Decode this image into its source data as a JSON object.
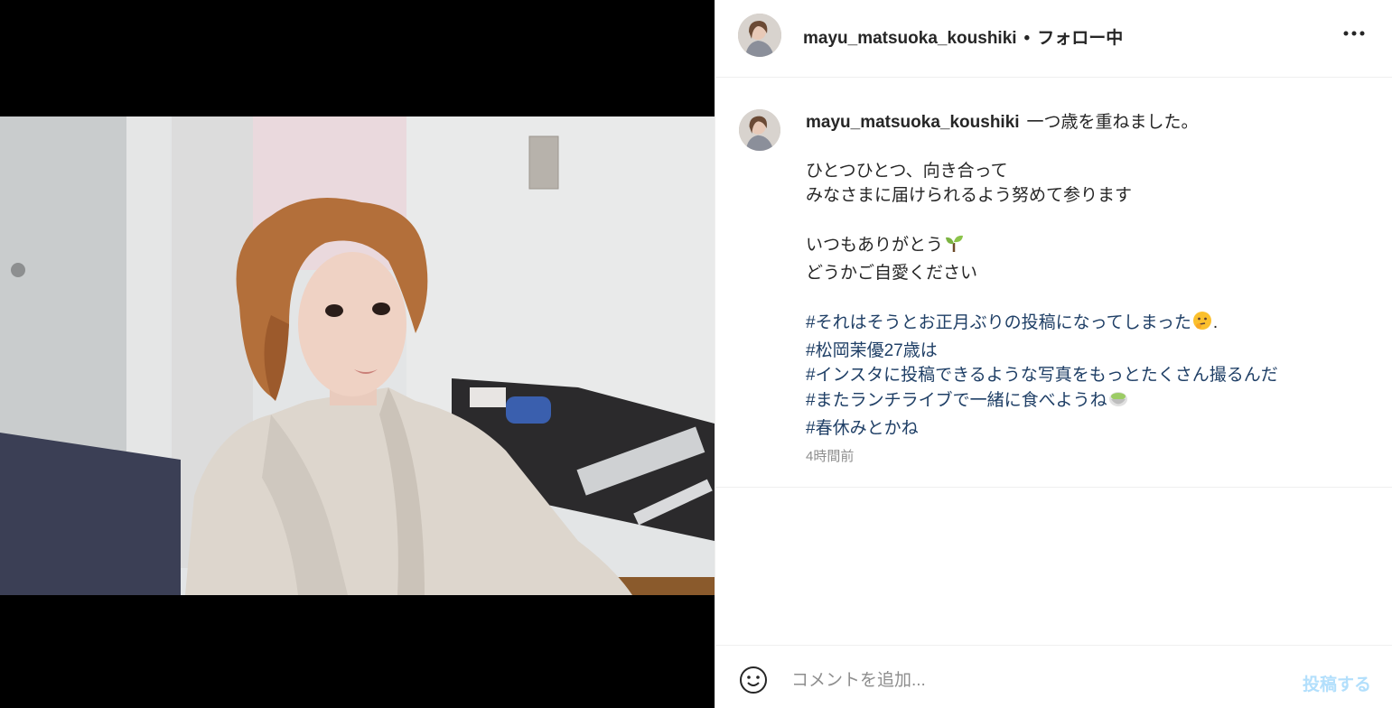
{
  "header": {
    "username": "mayu_matsuoka_koushiki",
    "separator": "•",
    "follow_status": "フォロー中",
    "more_icon": "more-horizontal-icon"
  },
  "caption": {
    "username": "mayu_matsuoka_koushiki",
    "line1": "一つ歳を重ねました。",
    "line2": "ひとつひとつ、向き合って",
    "line3": "みなさまに届けられるよう努めて参ります",
    "line4": "いつもありがとう",
    "line5": "どうかご自愛ください",
    "tag1": "#それはそうとお正月ぶりの投稿になってしまった",
    "tag1_suffix": ".",
    "tag2": "#松岡茉優27歳は",
    "tag3": "#インスタに投稿できるような写真をもっとたくさん撮るんだ",
    "tag4": "#またランチライブで一緒に食べようね",
    "tag5": "#春休みとかね",
    "emoji_sprout": "seedling-emoji",
    "emoji_thinking": "thinking-face-emoji",
    "emoji_tea": "teacup-emoji",
    "timestamp": "4時間前"
  },
  "comment": {
    "placeholder": "コメントを追加...",
    "post_label": "投稿する",
    "smile_icon": "smiley-icon"
  },
  "colors": {
    "hashtag": "#1f3f66",
    "post_disabled": "#b2dffc",
    "muted": "#8e8e8e",
    "border": "#efefef"
  }
}
